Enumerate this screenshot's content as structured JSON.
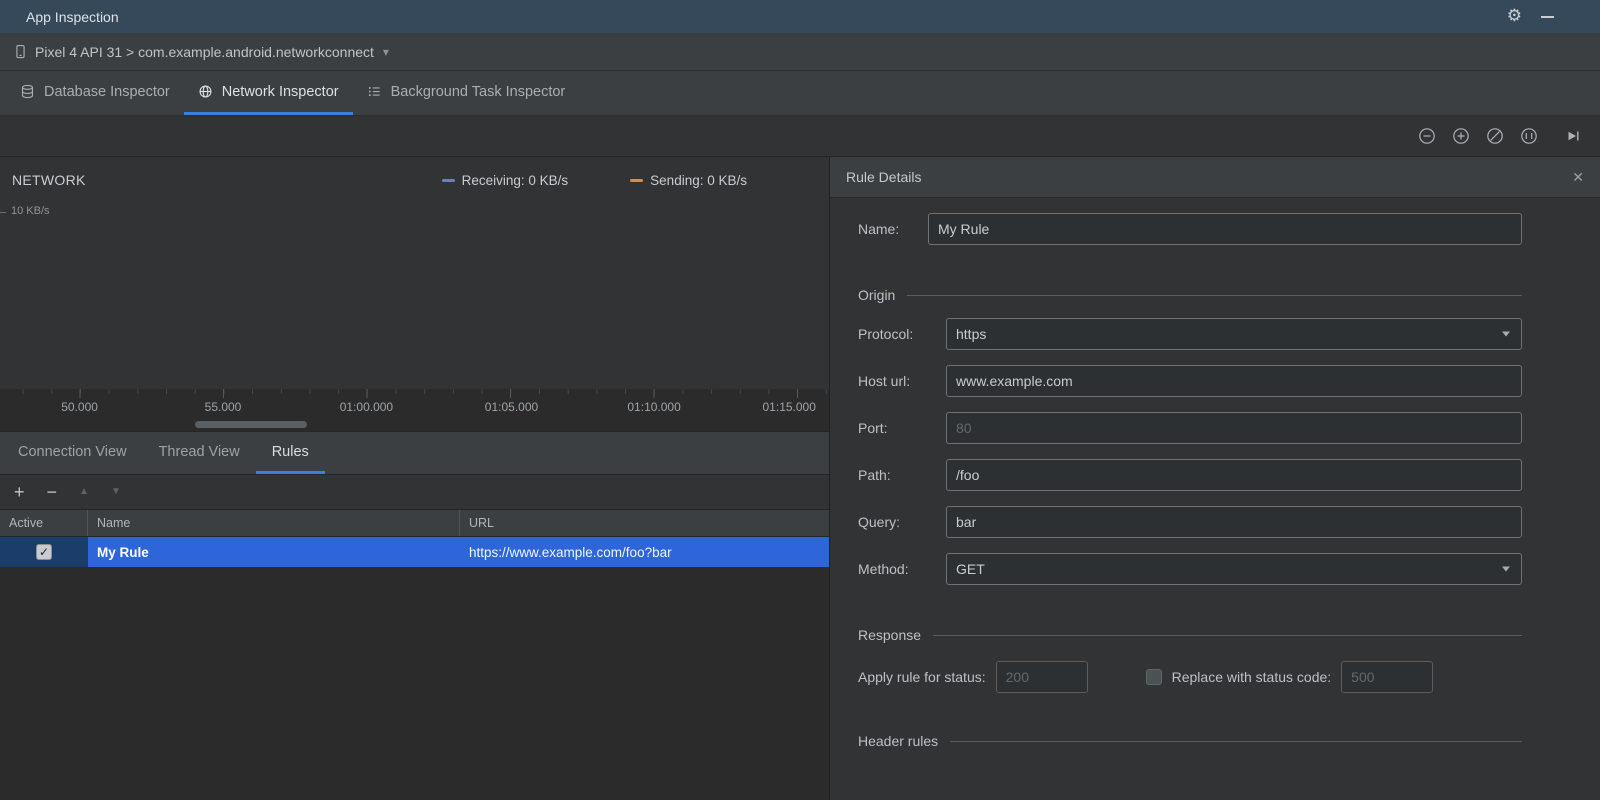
{
  "theme": {
    "accent": "#3D7EDF",
    "titlebar_color": "#36495A",
    "selection_color": "#2E66D9",
    "selection_active_color": "#1B3D69"
  },
  "icons": {
    "gear": "⚙",
    "chevron_down": "▾",
    "close": "✕",
    "check": "✓",
    "add": "+",
    "remove": "−",
    "move_up": "▲",
    "move_down": "▼"
  },
  "titlebar": {
    "title": "App Inspection"
  },
  "device_bar": {
    "selection": "Pixel 4 API 31 > com.example.android.networkconnect"
  },
  "inspector_tabs": {
    "database": "Database Inspector",
    "network": "Network Inspector",
    "background_task": "Background Task Inspector"
  },
  "network_chart": {
    "title": "NETWORK",
    "y_axis_label": "10 KB/s",
    "legend": {
      "receiving_label": "Receiving: 0 KB/s",
      "receiving_color": "#6283C4",
      "sending_label": "Sending: 0 KB/s",
      "sending_color": "#D28D50"
    },
    "x_ticks": [
      "50.000",
      "55.000",
      "01:00.000",
      "01:05.000",
      "01:10.000",
      "01:15.000"
    ]
  },
  "view_tabs": {
    "connection": "Connection View",
    "thread": "Thread View",
    "rules": "Rules"
  },
  "rules_table": {
    "headers": {
      "active": "Active",
      "name": "Name",
      "url": "URL"
    },
    "rows": [
      {
        "active": true,
        "name": "My Rule",
        "url": "https://www.example.com/foo?bar"
      }
    ],
    "selection_color": "#2E66D9",
    "selection_active_color": "#1B3D69"
  },
  "rule_details": {
    "title": "Rule Details",
    "name_label": "Name:",
    "name_value": "My Rule",
    "origin_title": "Origin",
    "protocol_label": "Protocol:",
    "protocol_value": "https",
    "host_label": "Host url:",
    "host_value": "www.example.com",
    "port_label": "Port:",
    "port_placeholder": "80",
    "path_label": "Path:",
    "path_value": "/foo",
    "query_label": "Query:",
    "query_value": "bar",
    "method_label": "Method:",
    "method_value": "GET",
    "response_title": "Response",
    "apply_label": "Apply rule for status:",
    "apply_placeholder": "200",
    "replace_label": "Replace with status code:",
    "replace_placeholder": "500",
    "header_rules_title": "Header rules"
  }
}
